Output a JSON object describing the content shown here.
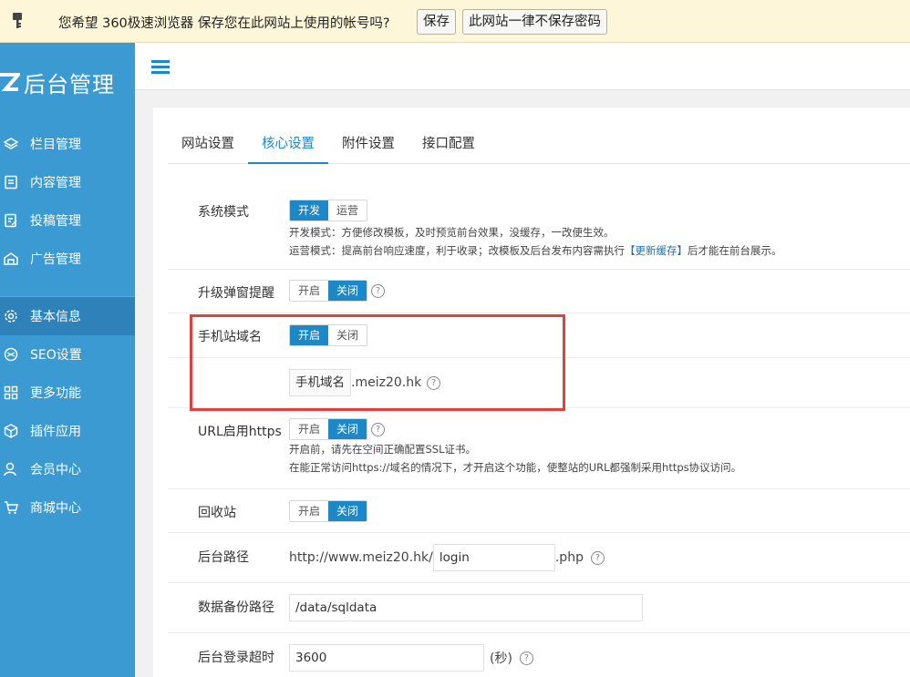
{
  "password_bar": {
    "message": "您希望 360极速浏览器 保存您在此网站上使用的帐号吗?",
    "save_label": "保存",
    "never_label": "此网站一律不保存密码"
  },
  "sidebar": {
    "logo_text": "后台管理",
    "items": [
      {
        "label": "栏目管理",
        "icon": "layers-icon"
      },
      {
        "label": "内容管理",
        "icon": "document-icon"
      },
      {
        "label": "投稿管理",
        "icon": "edit-icon"
      },
      {
        "label": "广告管理",
        "icon": "ad-icon"
      },
      {
        "label": "基本信息",
        "icon": "gear-icon"
      },
      {
        "label": "SEO设置",
        "icon": "seo-icon"
      },
      {
        "label": "更多功能",
        "icon": "grid-icon"
      },
      {
        "label": "插件应用",
        "icon": "cube-icon"
      },
      {
        "label": "会员中心",
        "icon": "user-icon"
      },
      {
        "label": "商城中心",
        "icon": "cart-icon"
      }
    ]
  },
  "tabs": [
    "网站设置",
    "核心设置",
    "附件设置",
    "接口配置"
  ],
  "settings": {
    "system_mode": {
      "label": "系统模式",
      "options": [
        "开发",
        "运营"
      ],
      "hint1": "开发模式：方便修改模板，及时预览前台效果，没缓存，一改便生效。",
      "hint2_pre": "运营模式：提高前台响应速度，利于收录；改模板及后台发布内容需执行",
      "hint2_link": "【更新缓存】",
      "hint2_post": "后才能在前台展示。"
    },
    "upgrade_popup": {
      "label": "升级弹窗提醒",
      "options": [
        "开启",
        "关闭"
      ]
    },
    "mobile_domain": {
      "label": "手机站域名",
      "options": [
        "开启",
        "关闭"
      ],
      "input_value": "手机域名",
      "suffix": ".meiz20.hk"
    },
    "https": {
      "label": "URL启用https",
      "options": [
        "开启",
        "关闭"
      ],
      "hint1": "开启前，请先在空间正确配置SSL证书。",
      "hint2": "在能正常访问https://域名的情况下，才开启这个功能，使整站的URL都强制采用https协议访问。"
    },
    "recycle": {
      "label": "回收站",
      "options": [
        "开启",
        "关闭"
      ]
    },
    "admin_path": {
      "label": "后台路径",
      "prefix": "http://www.meiz20.hk/",
      "value": "login",
      "suffix": ".php"
    },
    "backup_path": {
      "label": "数据备份路径",
      "value": "/data/sqldata"
    },
    "login_timeout": {
      "label": "后台登录超时",
      "value": "3600",
      "unit": "(秒)"
    }
  },
  "colors": {
    "sidebar": "#3c9ad2",
    "accent": "#1e88c7",
    "highlight": "#e04040"
  }
}
